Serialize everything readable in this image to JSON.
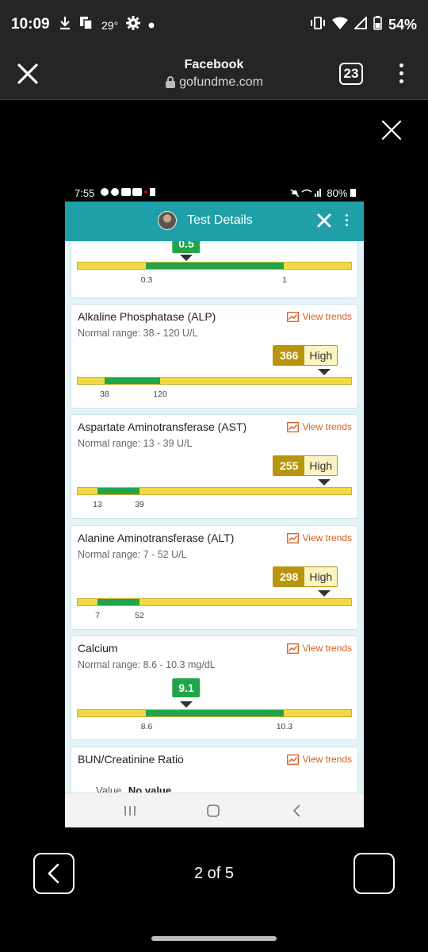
{
  "status_bar": {
    "time": "10:09",
    "temp": "29°",
    "battery": "54%"
  },
  "browser": {
    "title": "Facebook",
    "url": "gofundme.com",
    "tab_count": "23"
  },
  "viewer": {
    "pager": "2 of 5"
  },
  "inner_status": {
    "time": "7:55",
    "battery": "80%"
  },
  "app_header": {
    "title": "Test Details"
  },
  "top_partial": {
    "value": "0.5",
    "tick_low": "0.3",
    "tick_high": "1"
  },
  "tests": [
    {
      "name": "Alkaline Phosphatase (ALP)",
      "range": "Normal range: 38 - 120 U/L",
      "trends": "View trends",
      "value": "366",
      "flag": "High",
      "tick_low": "38",
      "tick_high": "120"
    },
    {
      "name": "Aspartate Aminotransferase (AST)",
      "range": "Normal range: 13 - 39 U/L",
      "trends": "View trends",
      "value": "255",
      "flag": "High",
      "tick_low": "13",
      "tick_high": "39"
    },
    {
      "name": "Alanine Aminotransferase (ALT)",
      "range": "Normal range: 7 - 52 U/L",
      "trends": "View trends",
      "value": "298",
      "flag": "High",
      "tick_low": "7",
      "tick_high": "52"
    },
    {
      "name": "Calcium",
      "range": "Normal range: 8.6 - 10.3 mg/dL",
      "trends": "View trends",
      "value": "9.1",
      "tick_low": "8.6",
      "tick_high": "10.3"
    },
    {
      "name": "BUN/Creatinine Ratio",
      "trends": "View trends",
      "value_label": "Value",
      "value": "No value"
    }
  ],
  "colors": {
    "header_teal": "#1f9fa8",
    "normal_green": "#22a54a",
    "bar_yellow": "#f1d944",
    "high_gold": "#b8950d",
    "trend_orange": "#d55d20"
  }
}
